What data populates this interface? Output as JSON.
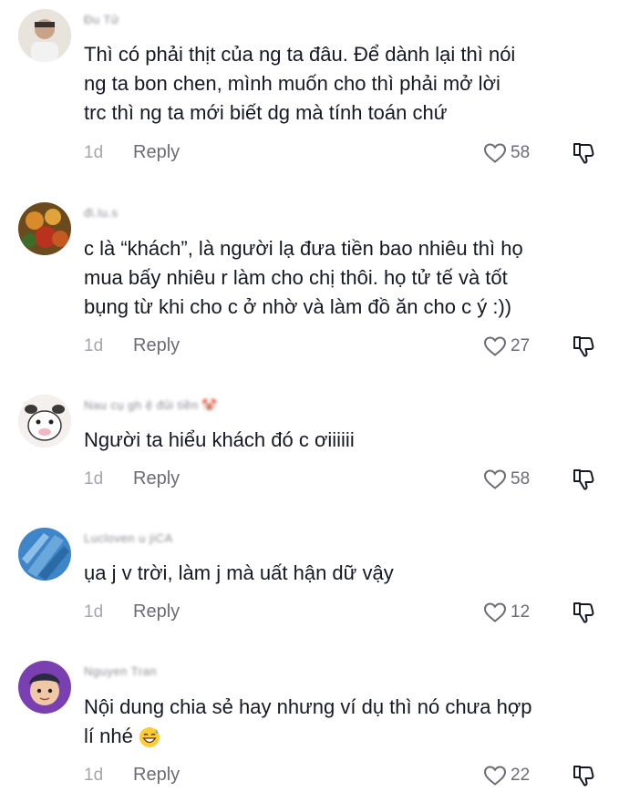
{
  "comments": [
    {
      "username": "Đu Tử",
      "text": "Thì có phải thịt của ng ta đâu. Để dành lại thì nói\nng ta bon chen, mình muốn cho thì phải mở lời\ntrc thì ng ta mới biết dg mà tính toán chứ",
      "time": "1d",
      "reply_label": "Reply",
      "likes": "58"
    },
    {
      "username": "đi.lu.s",
      "text": "c là “khách”, là người lạ đưa tiền bao nhiêu thì họ\nmua bấy nhiêu r làm cho chị thôi. họ tử tế và tốt\nbụng từ khi cho c ở nhờ và làm đồ ăn cho c ý :))",
      "time": "1d",
      "reply_label": "Reply",
      "likes": "27"
    },
    {
      "username": "Nau cụ gh ệ đủi tiền 🤡",
      "text": "Người ta hiểu khách đó c ơiiiiii",
      "time": "1d",
      "reply_label": "Reply",
      "likes": "58"
    },
    {
      "username": "Lucloven u jiCA",
      "text": "ụa j v trời, làm j mà uất hận dữ vậy",
      "time": "1d",
      "reply_label": "Reply",
      "likes": "12"
    },
    {
      "username": "Nguyen Tran",
      "text": "Nội dung chia sẻ hay nhưng ví dụ thì nó chưa hợp\nlí nhé",
      "time": "1d",
      "reply_label": "Reply",
      "likes": "22"
    }
  ],
  "icons": {
    "like": "heart-outline-icon",
    "dislike": "thumbs-down-icon",
    "emoji": "grinning-sweat-emoji"
  },
  "colors": {
    "text": "#161823",
    "meta": "#a5a6ab",
    "action": "#6b6c73"
  }
}
